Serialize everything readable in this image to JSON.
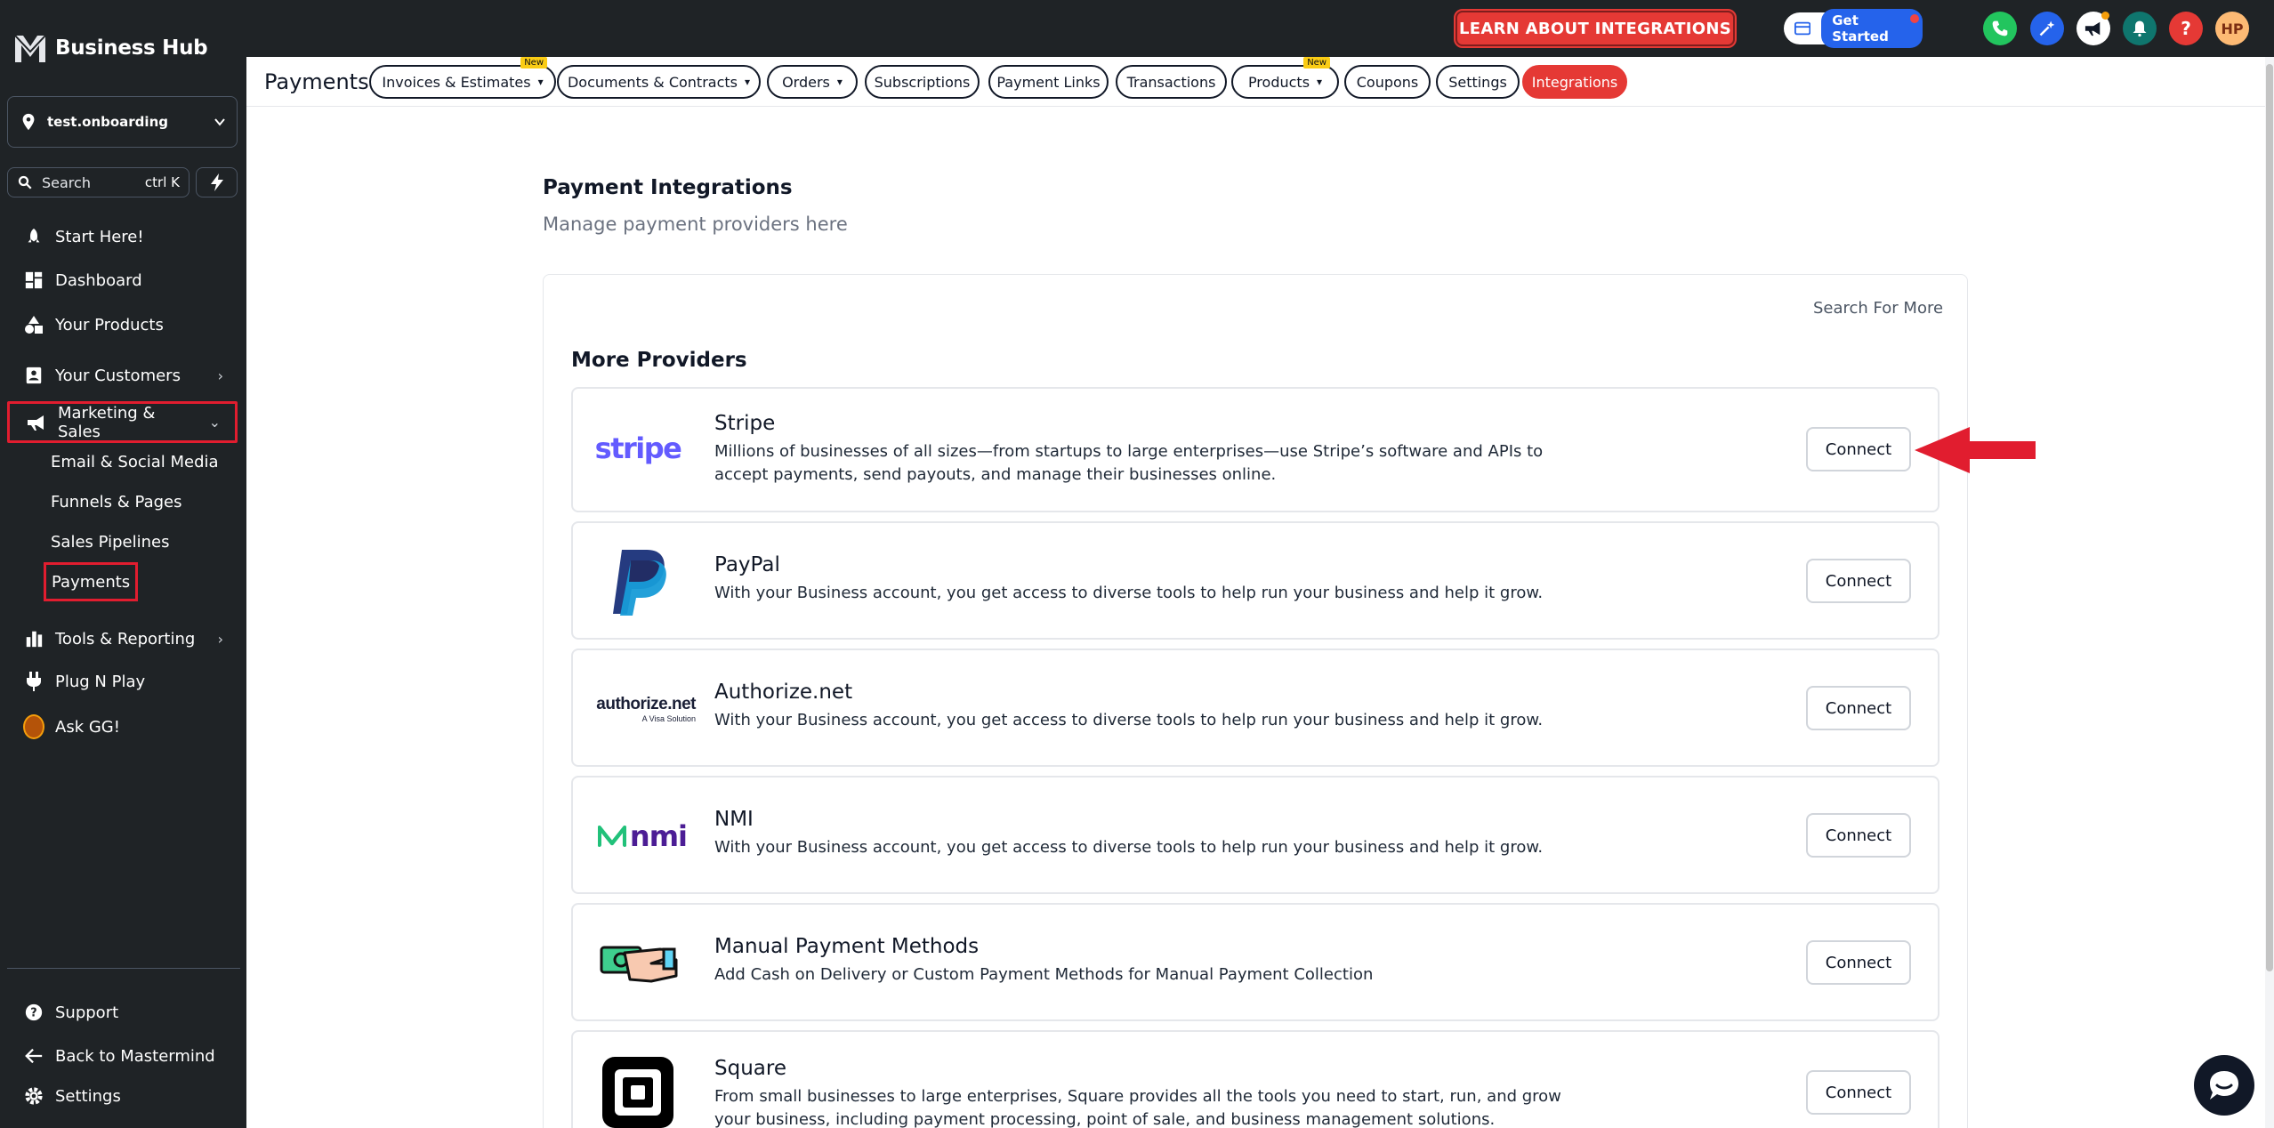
{
  "app": {
    "name": "Business Hub"
  },
  "sidebar": {
    "location": "test.onboarding",
    "search": {
      "label": "Search",
      "shortcut": "ctrl K"
    },
    "items": [
      {
        "label": "Start Here!",
        "icon": "rocket-icon"
      },
      {
        "label": "Dashboard",
        "icon": "dashboard-icon"
      },
      {
        "label": "Your Products",
        "icon": "shapes-icon"
      },
      {
        "label": "Your Customers",
        "icon": "contacts-icon"
      },
      {
        "label": "Marketing & Sales",
        "icon": "megaphone-icon"
      },
      {
        "label": "Tools & Reporting",
        "icon": "bar-chart-icon"
      },
      {
        "label": "Plug N Play",
        "icon": "plug-icon"
      },
      {
        "label": "Ask GG!",
        "icon": "avatar-icon"
      }
    ],
    "subitems": [
      "Email & Social Media",
      "Funnels & Pages",
      "Sales Pipelines",
      "Payments"
    ],
    "footer": [
      {
        "label": "Support",
        "icon": "help-circle-icon"
      },
      {
        "label": "Back to Mastermind",
        "icon": "arrow-left-icon"
      },
      {
        "label": "Settings",
        "icon": "gear-icon"
      }
    ]
  },
  "topbar": {
    "learn_label": "LEARN ABOUT INTEGRATIONS",
    "get_started_label": "Get Started",
    "help_label": "?",
    "avatar_initials": "HP"
  },
  "tabbar": {
    "title": "Payments",
    "tabs": [
      {
        "label": "Invoices & Estimates",
        "badge": "New"
      },
      {
        "label": "Documents & Contracts"
      },
      {
        "label": "Orders"
      },
      {
        "label": "Subscriptions"
      },
      {
        "label": "Payment Links"
      },
      {
        "label": "Transactions"
      },
      {
        "label": "Products",
        "badge": "New"
      },
      {
        "label": "Coupons"
      },
      {
        "label": "Settings"
      },
      {
        "label": "Integrations"
      }
    ]
  },
  "main": {
    "title": "Payment Integrations",
    "subtitle": "Manage payment providers here",
    "search_more": "Search For More",
    "section_title": "More Providers",
    "connect_label": "Connect",
    "providers": [
      {
        "name": "Stripe",
        "logo_text": "stripe",
        "description": "Millions of businesses of all sizes—from startups to large enterprises—use Stripe’s software and APIs to accept payments, send payouts, and manage their businesses online."
      },
      {
        "name": "PayPal",
        "description": "With your Business account, you get access to diverse tools to help run your business and help it grow."
      },
      {
        "name": "Authorize.net",
        "logo_text": "authorize.net",
        "logo_subtext": "A Visa Solution",
        "description": "With your Business account, you get access to diverse tools to help run your business and help it grow."
      },
      {
        "name": "NMI",
        "logo_text": "nmi",
        "description": "With your Business account, you get access to diverse tools to help run your business and help it grow."
      },
      {
        "name": "Manual Payment Methods",
        "description": "Add Cash on Delivery or Custom Payment Methods for Manual Payment Collection"
      },
      {
        "name": "Square",
        "description": "From small businesses to large enterprises, Square provides all the tools you need to start, run, and grow your business, including payment processing, point of sale, and business management solutions."
      }
    ]
  },
  "colors": {
    "sidebar_bg": "#1f2326",
    "accent_red": "#e53935",
    "stripe_purple": "#635bff",
    "paypal_dark": "#253b80",
    "paypal_light": "#179bd7"
  }
}
